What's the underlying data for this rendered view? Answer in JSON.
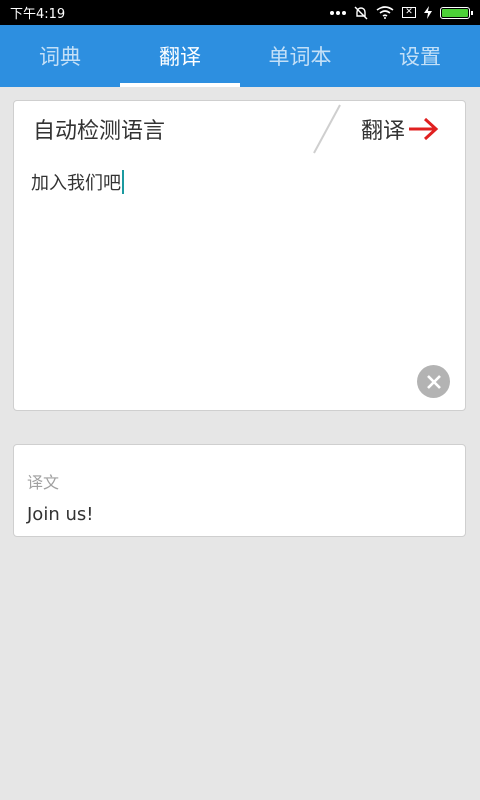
{
  "status": {
    "time": "下午4:19",
    "icons": [
      "more-dots-icon",
      "bell-muted-icon",
      "wifi-icon",
      "sim-x-icon",
      "charging-icon",
      "battery-icon"
    ],
    "sim_mark": "✕",
    "battery_level": 1.0
  },
  "tabs": [
    {
      "label": "词典",
      "active": false
    },
    {
      "label": "翻译",
      "active": true
    },
    {
      "label": "单词本",
      "active": false
    },
    {
      "label": "设置",
      "active": false
    }
  ],
  "input": {
    "source_language": "自动检测语言",
    "translate_label": "翻译",
    "text": "加入我们吧"
  },
  "output": {
    "label": "译文",
    "text": "Join us!"
  },
  "colors": {
    "accent": "#2d8fe0",
    "arrow": "#e02020",
    "background": "#e6e6e6",
    "battery": "#4cd137"
  }
}
